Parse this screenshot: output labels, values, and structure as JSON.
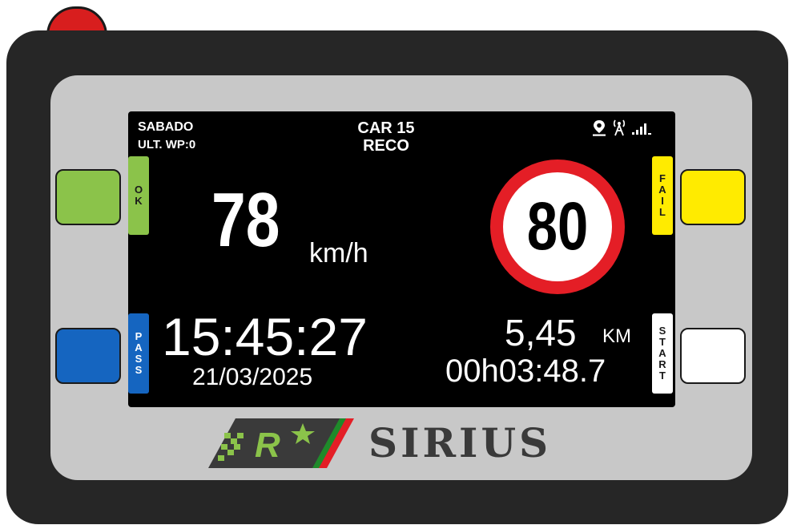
{
  "device": {
    "brand": "SIRIUS",
    "colors": {
      "ok": "#8bc34a",
      "pass": "#1565c0",
      "fail": "#ffeb00",
      "start": "#ffffff",
      "power": "#d81e1e",
      "speed_sign_ring": "#e41e26"
    }
  },
  "status": {
    "day": "SABADO",
    "last_wp": "ULT. WP:0",
    "car": "CAR 15",
    "mode": "RECO",
    "icons": [
      "location-pin-icon",
      "antenna-icon",
      "signal-bars-icon"
    ]
  },
  "speed": {
    "value": "78",
    "unit": "km/h"
  },
  "limit": {
    "value": "80"
  },
  "clock": {
    "time": "15:45:27",
    "date": "21/03/2025"
  },
  "trip": {
    "distance": "5,45",
    "distance_unit": "KM",
    "elapsed": "00h03:48.7"
  },
  "buttons": {
    "ok": "OK",
    "pass": "PASS",
    "fail": "FAIL",
    "start": "START"
  }
}
